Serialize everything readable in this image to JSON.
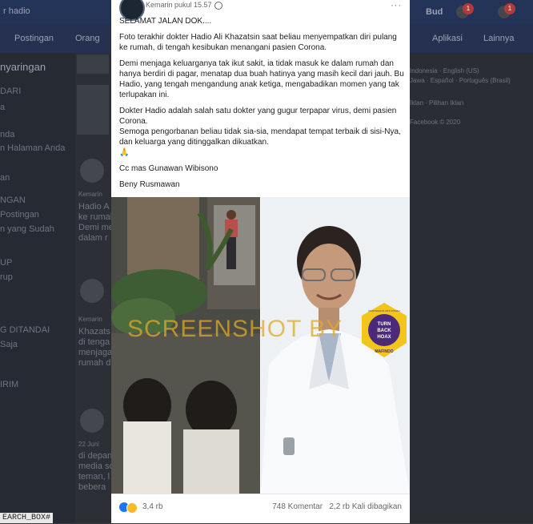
{
  "background": {
    "search_text": "r hadio",
    "profile_name": "Bud",
    "nav_items": [
      "Postingan",
      "Orang",
      "Aplikasi",
      "Lainnya"
    ],
    "page_title": "nyaringan",
    "left_labels": [
      "DARI",
      "a",
      "nda",
      "n Halaman Anda",
      "an",
      "NGAN",
      "Postingan",
      "n yang Sudah",
      "UP",
      "rup",
      "G DITANDAI",
      "Saja",
      "IRIM"
    ],
    "middle_labels": [
      "Kemarin",
      "Hadio A",
      "ke rumah",
      "Demi me",
      "dalam r",
      "Kemarin",
      "Khazats",
      "di tenga",
      "menjaga",
      "rumah d",
      "22 Juni",
      "di depan",
      "media so",
      "teman, l",
      "bebera"
    ],
    "right_labels": [
      "Indonesia · English (US)",
      "Jawa · Español · Português (Brasil)",
      "Iklan · Pilihan Iklan",
      "Facebook © 2020"
    ],
    "notification_badges": [
      "1",
      "1"
    ],
    "status_bar": "EARCH_BOX#"
  },
  "post": {
    "time": "Kemarin pukul 15.57",
    "more": "···",
    "paragraphs": [
      "SELAMAT JALAN DOK....",
      "Foto terakhir dokter Hadio Ali Khazatsin saat beliau menyempatkan diri pulang ke rumah, di tengah kesibukan menangani pasien Corona.",
      "Demi menjaga keluarganya tak ikut sakit, ia tidak masuk ke dalam rumah dan hanya berdiri di pagar, menatap dua buah hatinya yang masih kecil dari jauh. Bu Hadio, yang tengah mengandung anak ketiga, mengabadikan momen yang tak terlupakan ini.",
      "Dokter Hadio adalah salah satu dokter yang gugur terpapar virus, demi pasien Corona.\nSemoga pengorbanan beliau tidak sia-sia, mendapat tempat terbaik di sisi-Nya, dan keluarga yang ditinggalkan dikuatkan.\n🙏",
      "Cc mas Gunawan Wibisono",
      "Beny Rusmawan"
    ],
    "watermark": "SCREENSHOT BY",
    "mafindo": {
      "arc_top": "MASYARAKAT ANTI FITNAH INDONESIA",
      "center": "TURN BACK HOAX",
      "bottom": "MAFINDO"
    },
    "reactions_count": "3,4 rb",
    "comments": "748 Komentar",
    "shares": "2,2 rb Kali dibagikan"
  },
  "colors": {
    "facebook_blue": "#1877f2",
    "watermark": "#e0a828",
    "mafindo_yellow": "#f2c51a",
    "mafindo_purple": "#4b2a7a"
  }
}
